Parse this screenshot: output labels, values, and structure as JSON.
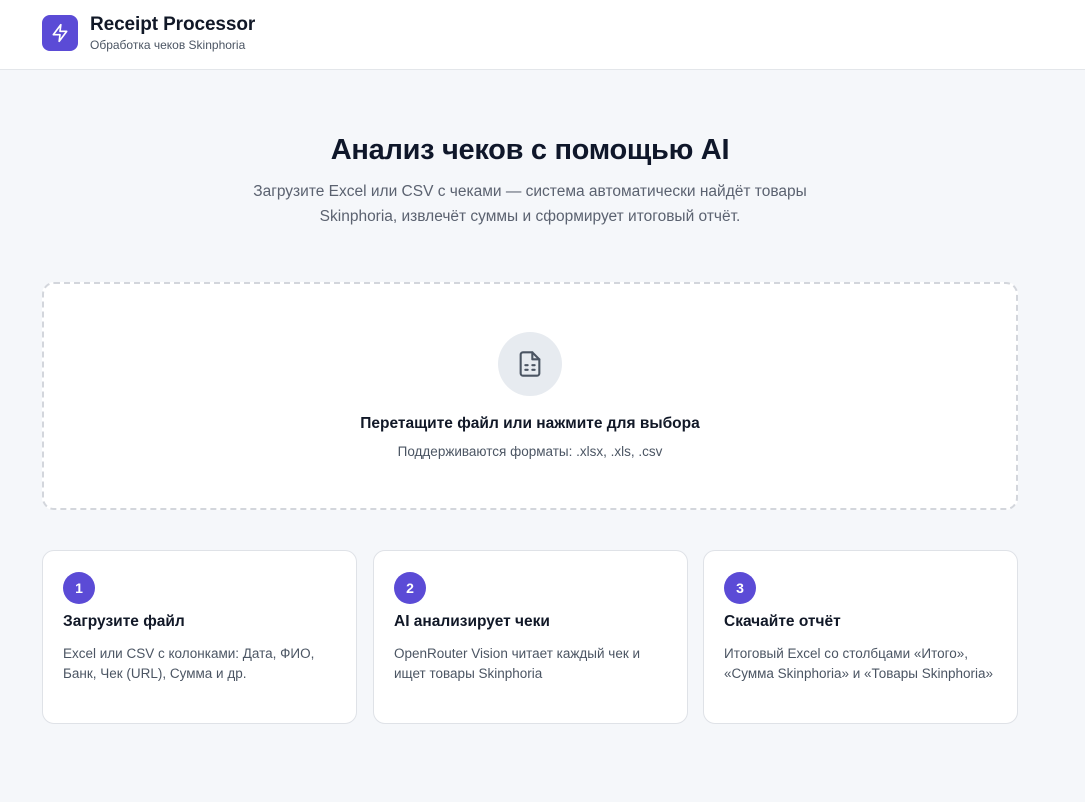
{
  "header": {
    "title": "Receipt Processor",
    "subtitle": "Обработка чеков Skinphoria",
    "logo_icon": "lightning-bolt-icon"
  },
  "hero": {
    "title": "Анализ чеков с помощью AI",
    "description": "Загрузите Excel или CSV с чеками — система автоматически найдёт товары Skinphoria, извлечёт суммы и сформирует итоговый отчёт."
  },
  "dropzone": {
    "icon": "file-spreadsheet-icon",
    "title": "Перетащите файл или нажмите для выбора",
    "subtitle": "Поддерживаются форматы: .xlsx, .xls, .csv"
  },
  "steps": [
    {
      "number": "1",
      "title": "Загрузите файл",
      "description": "Excel или CSV с колонками: Дата, ФИО, Банк, Чек (URL), Сумма и др."
    },
    {
      "number": "2",
      "title": "AI анализирует чеки",
      "description": "OpenRouter Vision читает каждый чек и ищет товары Skinphoria"
    },
    {
      "number": "3",
      "title": "Скачайте отчёт",
      "description": "Итоговый Excel со столбцами «Итого», «Сумма Skinphoria» и «Товары Skinphoria»"
    }
  ],
  "colors": {
    "accent": "#5b4bd6",
    "background": "#f5f7fa",
    "card": "#ffffff"
  }
}
